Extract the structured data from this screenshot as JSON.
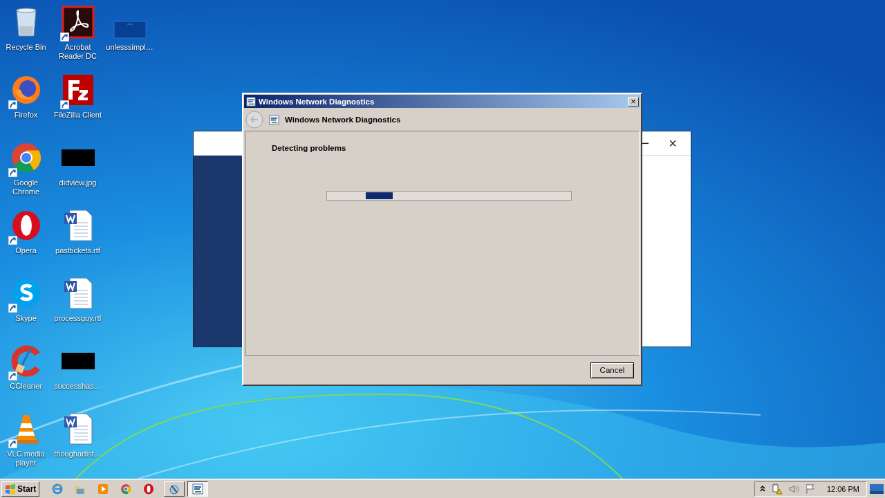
{
  "desktop": {
    "icons": [
      {
        "label": "Recycle Bin",
        "kind": "recycle",
        "shortcut": false
      },
      {
        "label": "Firefox",
        "kind": "firefox",
        "shortcut": true
      },
      {
        "label": "Google Chrome",
        "kind": "chrome",
        "shortcut": true
      },
      {
        "label": "Opera",
        "kind": "opera",
        "shortcut": true
      },
      {
        "label": "Skype",
        "kind": "skype",
        "shortcut": true
      },
      {
        "label": "CCleaner",
        "kind": "ccleaner",
        "shortcut": true
      },
      {
        "label": "VLC media player",
        "kind": "vlc",
        "shortcut": true
      },
      {
        "label": "Acrobat Reader DC",
        "kind": "acrobat",
        "shortcut": true
      },
      {
        "label": "FileZilla Client",
        "kind": "filezilla",
        "shortcut": true
      },
      {
        "label": "didview.jpg",
        "kind": "image",
        "shortcut": false
      },
      {
        "label": "pasttickets.rtf",
        "kind": "document",
        "shortcut": false
      },
      {
        "label": "processguy.rtf",
        "kind": "document",
        "shortcut": false
      },
      {
        "label": "successhas…",
        "kind": "image",
        "shortcut": false
      },
      {
        "label": "thoughartist…",
        "kind": "document",
        "shortcut": false
      },
      {
        "label": "unlesssimpl…",
        "kind": "blank",
        "shortcut": false
      }
    ]
  },
  "background_window": {
    "minimize": "−",
    "close": "×"
  },
  "dialog": {
    "title": "Windows Network Diagnostics",
    "close": "×",
    "header": "Windows Network Diagnostics",
    "status": "Detecting problems",
    "progress": {
      "level": 0.16
    },
    "buttons": [
      "Cancel"
    ]
  },
  "taskbar": {
    "start": "Start",
    "pinned": [
      {
        "kind": "ie"
      },
      {
        "kind": "folder"
      },
      {
        "kind": "media"
      },
      {
        "kind": "chrome"
      },
      {
        "kind": "opera"
      }
    ],
    "tasks": [
      {
        "kind": "diagnostics",
        "selected": false
      },
      {
        "kind": "network",
        "selected": true
      }
    ],
    "tray": {
      "clock": "12:06 PM"
    }
  }
}
